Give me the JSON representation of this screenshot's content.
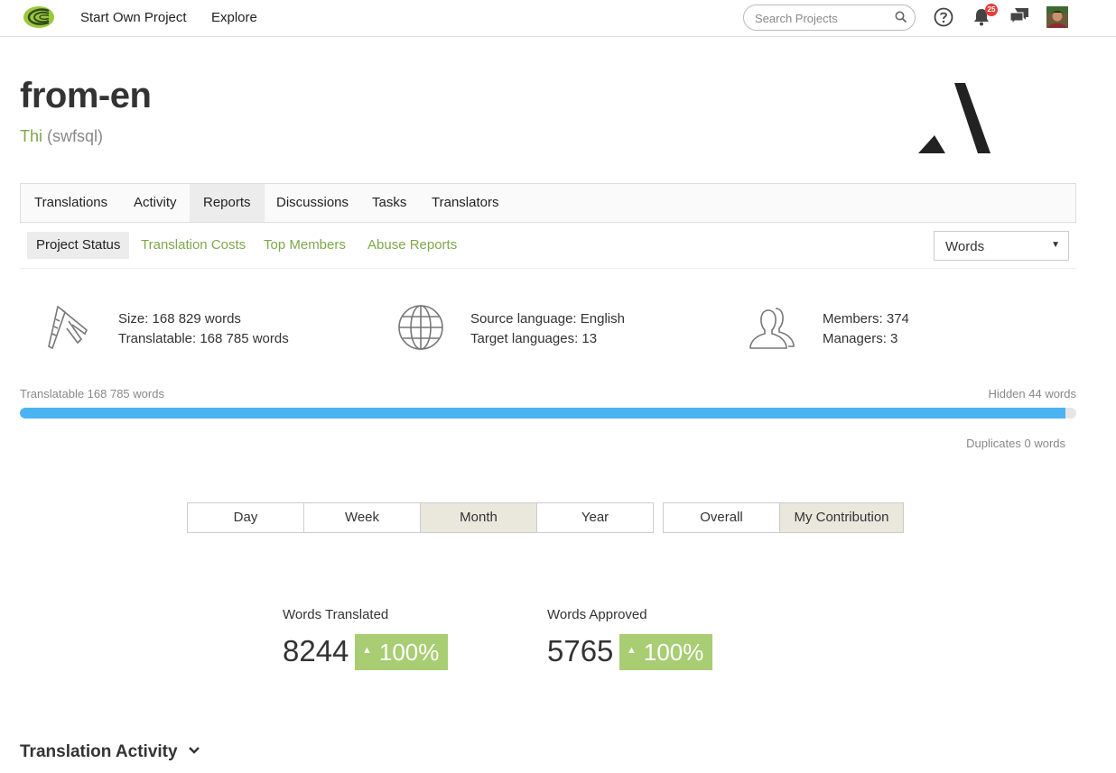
{
  "nav": {
    "links": [
      "Start Own Project",
      "Explore"
    ],
    "search_placeholder": "Search Projects",
    "notification_count": "25"
  },
  "project": {
    "title": "from-en",
    "owner_name": "Thi",
    "owner_handle": "(swfsql)"
  },
  "tabs": [
    "Translations",
    "Activity",
    "Reports",
    "Discussions",
    "Tasks",
    "Translators"
  ],
  "active_tab": "Reports",
  "subtabs": [
    "Project Status",
    "Translation Costs",
    "Top Members",
    "Abuse Reports"
  ],
  "active_subtab": "Project Status",
  "unit_select": "Words",
  "stats": {
    "size": "Size: 168 829 words",
    "translatable": "Translatable: 168 785 words",
    "source_language": "Source language: English",
    "target_languages": "Target languages: 13",
    "members": "Members: 374",
    "managers": "Managers: 3"
  },
  "progress": {
    "left_label": "Translatable 168 785 words",
    "right_label": "Hidden 44 words",
    "duplicates_label": "Duplicates 0 words",
    "fraction": 0.99
  },
  "periods": [
    "Day",
    "Week",
    "Month",
    "Year"
  ],
  "active_period": "Month",
  "scopes": [
    "Overall",
    "My Contribution"
  ],
  "active_scope": "My Contribution",
  "metrics": {
    "translated_label": "Words Translated",
    "translated_value": "8244",
    "translated_change": "100%",
    "approved_label": "Words Approved",
    "approved_value": "5765",
    "approved_change": "100%"
  },
  "section": {
    "title": "Translation Activity"
  },
  "colors": {
    "accent_green": "#7fa84c",
    "badge_green": "#a8cd73",
    "progress_blue": "#4cb3f2",
    "notification_red": "#e2403a"
  }
}
